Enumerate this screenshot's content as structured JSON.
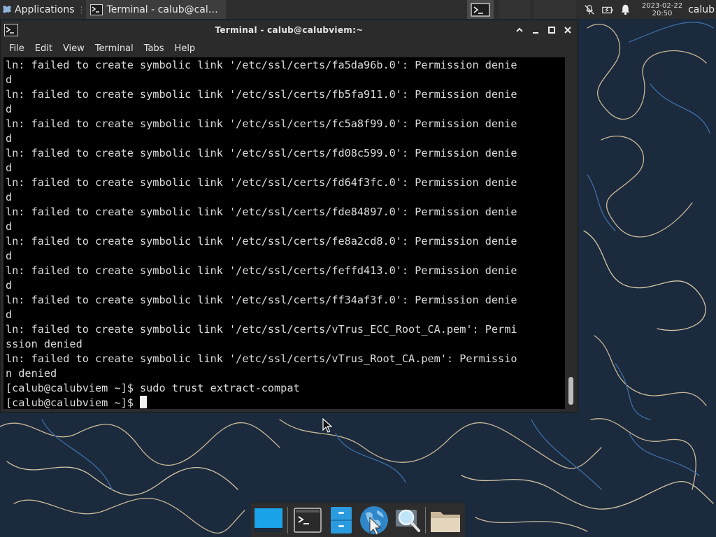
{
  "panel": {
    "apps_label": "Applications",
    "task_title": "Terminal - calub@cal…",
    "clock_date": "2023-02-22",
    "clock_time": "20:50",
    "user": "calub"
  },
  "window": {
    "title": "Terminal - calub@calubviem:~",
    "menu": [
      "File",
      "Edit",
      "View",
      "Terminal",
      "Tabs",
      "Help"
    ]
  },
  "terminal": {
    "lines": [
      "ln: failed to create symbolic link '/etc/ssl/certs/fa5da96b.0': Permission denie",
      "d",
      "ln: failed to create symbolic link '/etc/ssl/certs/fb5fa911.0': Permission denie",
      "d",
      "ln: failed to create symbolic link '/etc/ssl/certs/fc5a8f99.0': Permission denie",
      "d",
      "ln: failed to create symbolic link '/etc/ssl/certs/fd08c599.0': Permission denie",
      "d",
      "ln: failed to create symbolic link '/etc/ssl/certs/fd64f3fc.0': Permission denie",
      "d",
      "ln: failed to create symbolic link '/etc/ssl/certs/fde84897.0': Permission denie",
      "d",
      "ln: failed to create symbolic link '/etc/ssl/certs/fe8a2cd8.0': Permission denie",
      "d",
      "ln: failed to create symbolic link '/etc/ssl/certs/feffd413.0': Permission denie",
      "d",
      "ln: failed to create symbolic link '/etc/ssl/certs/ff34af3f.0': Permission denie",
      "d",
      "ln: failed to create symbolic link '/etc/ssl/certs/vTrus_ECC_Root_CA.pem': Permi",
      "ssion denied",
      "ln: failed to create symbolic link '/etc/ssl/certs/vTrus_Root_CA.pem': Permissio",
      "n denied",
      "[calub@calubviem ~]$ sudo trust extract-compat"
    ],
    "prompt": "[calub@calubviem ~]$ "
  },
  "icons": {
    "apps": "xfce-mouse-icon",
    "terminal": "terminal-icon",
    "tray": [
      "mic-muted-icon",
      "battery-icon",
      "notification-bell-icon"
    ],
    "dock": [
      "show-desktop-icon",
      "terminal-icon",
      "file-manager-icon",
      "web-browser-icon",
      "search-icon",
      "folder-icon"
    ]
  },
  "colors": {
    "panel_bg": "#2d2d2d",
    "terminal_bg": "#000000",
    "terminal_fg": "#dcdcdc",
    "wallpaper_bg": "#1b2a3c"
  }
}
